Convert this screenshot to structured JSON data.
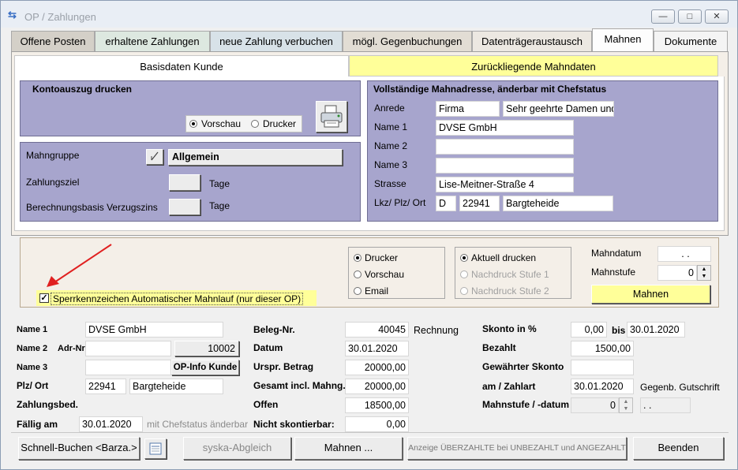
{
  "window": {
    "title": "OP / Zahlungen"
  },
  "tabs": [
    "Offene Posten",
    "erhaltene Zahlungen",
    "neue Zahlung verbuchen",
    "mögl. Gegenbuchungen",
    "Datenträgeraustausch",
    "Mahnen",
    "Dokumente"
  ],
  "subtabs": {
    "basis": "Basisdaten Kunde",
    "history": "Zurückliegende Mahndaten"
  },
  "konto": {
    "title": "Kontoauszug drucken",
    "opt_preview": "Vorschau",
    "opt_print": "Drucker"
  },
  "mahngruppe": {
    "label": "Mahngruppe",
    "value": "Allgemein",
    "zahlungsziel_label": "Zahlungsziel",
    "days_unit": "Tage",
    "verzugszins_label": "Berechnungsbasis Verzugszins",
    "days_unit2": "Tage"
  },
  "adresse": {
    "title": "Vollständige Mahnadresse, änderbar mit Chefstatus",
    "anrede_label": "Anrede",
    "anrede_value": "Firma",
    "salutation": "Sehr geehrte Damen und",
    "name1_label": "Name 1",
    "name1_value": "DVSE GmbH",
    "name2_label": "Name 2",
    "name3_label": "Name 3",
    "strasse_label": "Strasse",
    "strasse_value": "Lise-Meitner-Straße 4",
    "ort_label": "Lkz/ Plz/ Ort",
    "lkz": "D",
    "plz": "22941",
    "ort": "Bargteheide"
  },
  "output": {
    "opt_printer": "Drucker",
    "opt_preview": "Vorschau",
    "opt_email": "Email",
    "opt_current": "Aktuell drucken",
    "opt_reprint1": "Nachdruck Stufe 1",
    "opt_reprint2": "Nachdruck Stufe 2",
    "mahndatum_label": "Mahndatum",
    "mahndatum_value": ". .",
    "mahnstufe_label": "Mahnstufe",
    "mahnstufe_value": "0",
    "mahnen_button": "Mahnen",
    "sperr_label": "Sperrkennzeichen Automatischer Mahnlauf (nur dieser OP)"
  },
  "details": {
    "name1_label": "Name 1",
    "name1_value": "DVSE GmbH",
    "name2_label": "Name 2",
    "adrnr_label": "Adr-Nr.",
    "adrnr_value": "10002",
    "name3_label": "Name 3",
    "opinfo_button": "OP-Info Kunde",
    "plzort_label": "Plz/ Ort",
    "plz_value": "22941",
    "ort_value": "Bargteheide",
    "zahlungsbed_label": "Zahlungsbed.",
    "faellig_label": "Fällig am",
    "faellig_value": "30.01.2020",
    "chefstatus_note": "mit Chefstatus änderbar",
    "beleg_label": "Beleg-Nr.",
    "beleg_value": "40045",
    "beleg_type": "Rechnung",
    "datum_label": "Datum",
    "datum_value": "30.01.2020",
    "urspr_label": "Urspr. Betrag",
    "urspr_value": "20000,00",
    "gesamt_label": "Gesamt incl. Mahng.",
    "gesamt_value": "20000,00",
    "offen_label": "Offen",
    "offen_value": "18500,00",
    "nicht_label": "Nicht skontierbar:",
    "nicht_value": "0,00",
    "skonto_label": "Skonto in %",
    "skonto_value": "0,00",
    "bis_label": "bis",
    "bis_value": "30.01.2020",
    "bezahlt_label": "Bezahlt",
    "bezahlt_value": "1500,00",
    "gewaehrt_label": "Gewährter Skonto",
    "amzahlart_label": "am / Zahlart",
    "amzahlart_value": "30.01.2020",
    "zahlart": "Gegenb. Gutschrift",
    "mahnstufe_label": "Mahnstufe / -datum",
    "mahnstufe_value": "0",
    "mahndatum_value": ". ."
  },
  "footer": {
    "schnell_button": "Schnell-Buchen <Barza.>",
    "syska_button": "syska-Abgleich",
    "mahnen_button": "Mahnen ...",
    "anzeige_button": "Anzeige ÜBERZAHLTE bei UNBEZAHLT und ANGEZAHLT",
    "beenden_button": "Beenden"
  },
  "colors": {
    "purple_panel": "#a7a5cd",
    "yellow": "#ffff99",
    "arrow": "#e02020"
  }
}
